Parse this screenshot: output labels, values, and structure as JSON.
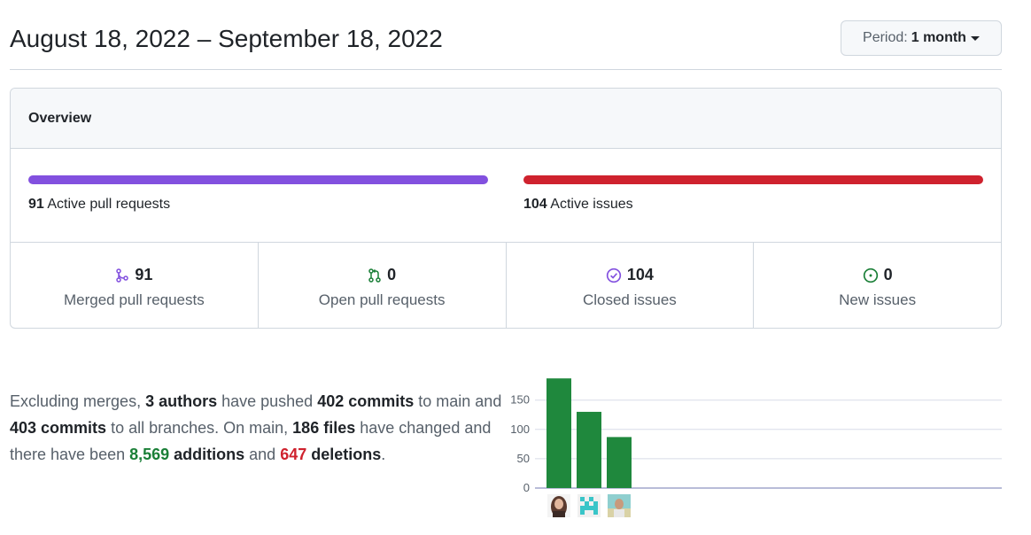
{
  "header": {
    "date_range": "August 18, 2022 – September 18, 2022",
    "period_label": "Period:",
    "period_value": "1 month"
  },
  "overview": {
    "title": "Overview",
    "active_pull_requests": {
      "count": "91",
      "label": "Active pull requests"
    },
    "active_issues": {
      "count": "104",
      "label": "Active issues"
    },
    "stats": [
      {
        "icon": "git-merge-icon",
        "count": "91",
        "label": "Merged pull requests",
        "color": "#8250df"
      },
      {
        "icon": "git-pull-request-icon",
        "count": "0",
        "label": "Open pull requests",
        "color": "#1a7f37"
      },
      {
        "icon": "issue-closed-icon",
        "count": "104",
        "label": "Closed issues",
        "color": "#8250df"
      },
      {
        "icon": "issue-opened-icon",
        "count": "0",
        "label": "New issues",
        "color": "#1a7f37"
      }
    ]
  },
  "summary": {
    "t1": "Excluding merges, ",
    "authors": "3 authors",
    "t2": " have pushed ",
    "commits_main": "402 commits",
    "t3": " to main and ",
    "commits_all": "403 commits",
    "t4": " to all branches. On main, ",
    "files": "186 files",
    "t5": " have changed and there have been ",
    "additions_num": "8,569",
    "additions_word": " additions",
    "t6": " and ",
    "deletions_num": "647",
    "deletions_word": " deletions",
    "t7": "."
  },
  "colors": {
    "purple": "#8250df",
    "red": "#cf222e",
    "green": "#1a7f37",
    "bar_green": "#1f883d"
  },
  "chart_data": {
    "type": "bar",
    "categories": [
      "author-1",
      "author-2",
      "author-3"
    ],
    "values": [
      187,
      130,
      87
    ],
    "y_ticks": [
      0,
      50,
      100,
      150
    ],
    "ylim": [
      0,
      190
    ],
    "grid": true
  }
}
